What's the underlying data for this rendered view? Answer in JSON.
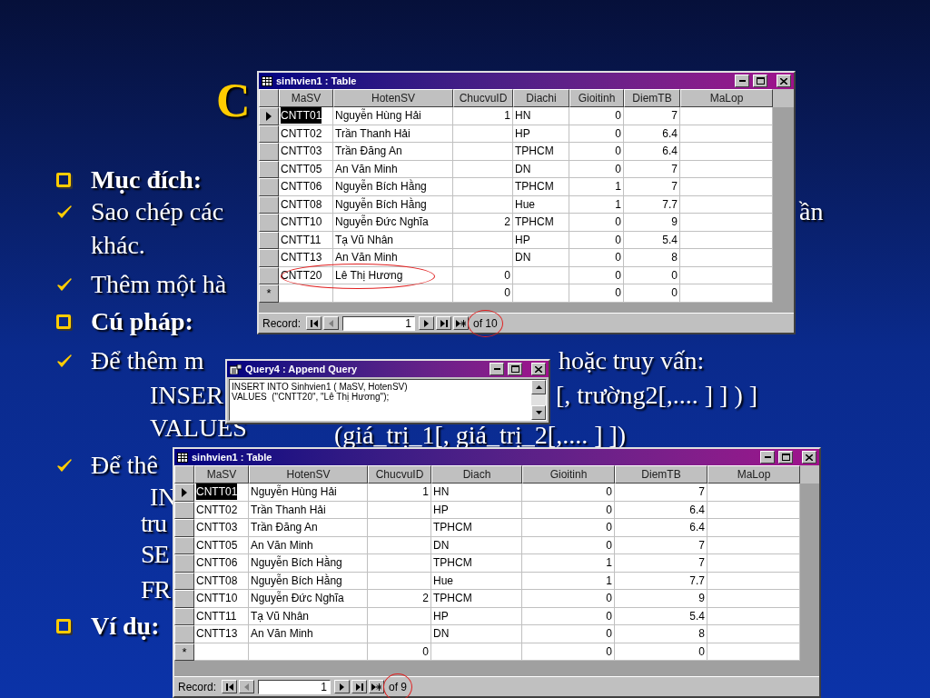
{
  "slide": {
    "title": "C",
    "lines": [
      {
        "kind": "heading",
        "segments": [
          "Mục đích:"
        ]
      },
      {
        "kind": "check",
        "segments": [
          "Sao chép các",
          "ần"
        ]
      },
      {
        "kind": "continuation",
        "segments": [
          "khác."
        ]
      },
      {
        "kind": "check",
        "segments": [
          "Thêm một hà"
        ]
      },
      {
        "kind": "heading",
        "segments": [
          "Cú pháp:"
        ]
      },
      {
        "kind": "check",
        "segments": [
          "Để thêm m",
          "hoặc truy vấn:"
        ]
      },
      {
        "kind": "code",
        "segments": [
          "INSER",
          "[, trường2[,.... ] ] ) ]"
        ]
      },
      {
        "kind": "code",
        "segments": [
          "VALUES",
          "(giá_trị_1[, giá_trị_2[,.... ] ])"
        ]
      },
      {
        "kind": "check",
        "segments": [
          "Để thê"
        ]
      },
      {
        "kind": "code",
        "segments": [
          "IN"
        ]
      },
      {
        "kind": "code",
        "segments": [
          "tru"
        ]
      },
      {
        "kind": "code",
        "segments": [
          "SE"
        ]
      },
      {
        "kind": "code",
        "segments": [
          "FR"
        ]
      },
      {
        "kind": "heading",
        "segments": [
          "Ví dụ:"
        ]
      }
    ]
  },
  "windows": [
    {
      "kind": "table",
      "title": "sinhvien1 : Table",
      "columns": [
        {
          "label": "MaSV",
          "kind": "text"
        },
        {
          "label": "HotenSV",
          "kind": "text"
        },
        {
          "label": "ChucvuID",
          "kind": "number"
        },
        {
          "label": "Diachi",
          "kind": "text"
        },
        {
          "label": "Gioitinh",
          "kind": "number"
        },
        {
          "label": "DiemTB",
          "kind": "number"
        },
        {
          "label": "MaLop",
          "kind": "text"
        }
      ],
      "rows": [
        {
          "selected": true,
          "circled": false,
          "cells": [
            "CNTT01",
            "Nguyễn Hùng Hải",
            "1",
            "HN",
            "0",
            "7",
            null
          ]
        },
        {
          "selected": false,
          "circled": false,
          "cells": [
            "CNTT02",
            "Trần Thanh Hải",
            null,
            "HP",
            "0",
            "6.4",
            null
          ]
        },
        {
          "selected": false,
          "circled": false,
          "cells": [
            "CNTT03",
            "Trần Đăng An",
            null,
            "TPHCM",
            "0",
            "6.4",
            null
          ]
        },
        {
          "selected": false,
          "circled": false,
          "cells": [
            "CNTT05",
            "An Văn Minh",
            null,
            "DN",
            "0",
            "7",
            null
          ]
        },
        {
          "selected": false,
          "circled": false,
          "cells": [
            "CNTT06",
            "Nguyễn Bích Hằng",
            null,
            "TPHCM",
            "1",
            "7",
            null
          ]
        },
        {
          "selected": false,
          "circled": false,
          "cells": [
            "CNTT08",
            "Nguyễn Bích Hằng",
            null,
            "Hue",
            "1",
            "7.7",
            null
          ]
        },
        {
          "selected": false,
          "circled": false,
          "cells": [
            "CNTT10",
            "Nguyễn Đức Nghĩa",
            "2",
            "TPHCM",
            "0",
            "9",
            null
          ]
        },
        {
          "selected": false,
          "circled": false,
          "cells": [
            "CNTT11",
            "Tạ Vũ Nhân",
            null,
            "HP",
            "0",
            "5.4",
            null
          ]
        },
        {
          "selected": false,
          "circled": false,
          "cells": [
            "CNTT13",
            "An Văn Minh",
            null,
            "DN",
            "0",
            "8",
            null
          ]
        },
        {
          "selected": false,
          "circled": true,
          "cells": [
            "CNTT20",
            "Lê Thị Hương",
            "0",
            null,
            "0",
            "0",
            null
          ]
        }
      ],
      "new_row": {
        "marker": "*",
        "cells": [
          null,
          null,
          "0",
          null,
          "0",
          "0",
          null
        ]
      },
      "record_bar": {
        "label": "Record:",
        "current": "1",
        "total": "of 10",
        "total_circled": true,
        "nav": [
          {
            "kind": "first",
            "disabled": false
          },
          {
            "kind": "prev",
            "disabled": true
          },
          {
            "kind": "next",
            "disabled": false
          },
          {
            "kind": "last",
            "disabled": false
          },
          {
            "kind": "new",
            "disabled": false
          }
        ]
      }
    },
    {
      "kind": "query",
      "title": "Query4 : Append Query",
      "sql": [
        "INSERT INTO Sinhvien1 ( MaSV, HotenSV)",
        "VALUES  (\"CNTT20\", \"Lê Thị Hương\");"
      ]
    },
    {
      "kind": "table",
      "title": "sinhvien1 : Table",
      "columns": [
        {
          "label": "MaSV",
          "kind": "text"
        },
        {
          "label": "HotenSV",
          "kind": "text"
        },
        {
          "label": "ChucvuID",
          "kind": "number"
        },
        {
          "label": "Diach",
          "kind": "text"
        },
        {
          "label": "Gioitinh",
          "kind": "number"
        },
        {
          "label": "DiemTB",
          "kind": "number"
        },
        {
          "label": "MaLop",
          "kind": "text"
        }
      ],
      "rows": [
        {
          "selected": true,
          "circled": false,
          "cells": [
            "CNTT01",
            "Nguyễn Hùng Hải",
            "1",
            "HN",
            "0",
            "7",
            null
          ]
        },
        {
          "selected": false,
          "circled": false,
          "cells": [
            "CNTT02",
            "Trần Thanh Hải",
            null,
            "HP",
            "0",
            "6.4",
            null
          ]
        },
        {
          "selected": false,
          "circled": false,
          "cells": [
            "CNTT03",
            "Trần Đăng An",
            null,
            "TPHCM",
            "0",
            "6.4",
            null
          ]
        },
        {
          "selected": false,
          "circled": false,
          "cells": [
            "CNTT05",
            "An Văn Minh",
            null,
            "DN",
            "0",
            "7",
            null
          ]
        },
        {
          "selected": false,
          "circled": false,
          "cells": [
            "CNTT06",
            "Nguyễn Bích Hằng",
            null,
            "TPHCM",
            "1",
            "7",
            null
          ]
        },
        {
          "selected": false,
          "circled": false,
          "cells": [
            "CNTT08",
            "Nguyễn Bích Hằng",
            null,
            "Hue",
            "1",
            "7.7",
            null
          ]
        },
        {
          "selected": false,
          "circled": false,
          "cells": [
            "CNTT10",
            "Nguyễn Đức Nghĩa",
            "2",
            "TPHCM",
            "0",
            "9",
            null
          ]
        },
        {
          "selected": false,
          "circled": false,
          "cells": [
            "CNTT11",
            "Tạ Vũ Nhân",
            null,
            "HP",
            "0",
            "5.4",
            null
          ]
        },
        {
          "selected": false,
          "circled": false,
          "cells": [
            "CNTT13",
            "An Văn Minh",
            null,
            "DN",
            "0",
            "8",
            null
          ]
        }
      ],
      "new_row": {
        "marker": "*",
        "cells": [
          null,
          null,
          "0",
          null,
          "0",
          "0",
          null
        ]
      },
      "record_bar": {
        "label": "Record:",
        "current": "1",
        "total": "of 9",
        "total_circled": true,
        "nav": [
          {
            "kind": "first",
            "disabled": false
          },
          {
            "kind": "prev",
            "disabled": true
          },
          {
            "kind": "next",
            "disabled": false
          },
          {
            "kind": "last",
            "disabled": false
          },
          {
            "kind": "new",
            "disabled": false
          }
        ]
      }
    }
  ]
}
